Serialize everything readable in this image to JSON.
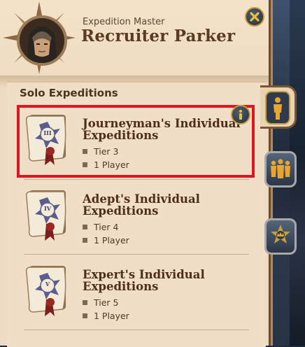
{
  "header": {
    "subtitle": "Expedition Master",
    "name": "Recruiter Parker"
  },
  "section": {
    "title": "Solo Expeditions"
  },
  "expeditions": [
    {
      "numeral": "III",
      "title": "Journeyman's Individual Expeditions",
      "tier": "Tier 3",
      "players": "1 Player",
      "selected": true
    },
    {
      "numeral": "IV",
      "title": "Adept's Individual Expeditions",
      "tier": "Tier 4",
      "players": "1 Player",
      "selected": false
    },
    {
      "numeral": "V",
      "title": "Expert's Individual Expeditions",
      "tier": "Tier 5",
      "players": "1 Player",
      "selected": false
    }
  ],
  "side_tabs": [
    {
      "icon": "solo-player-icon",
      "active": true
    },
    {
      "icon": "group-players-icon",
      "active": false
    },
    {
      "icon": "crown-badge-icon",
      "active": false
    }
  ],
  "colors": {
    "parchment": "#eedac0",
    "title_brown": "#5b3a22",
    "selection_red": "#e0141e",
    "gold": "#c89d3c"
  }
}
